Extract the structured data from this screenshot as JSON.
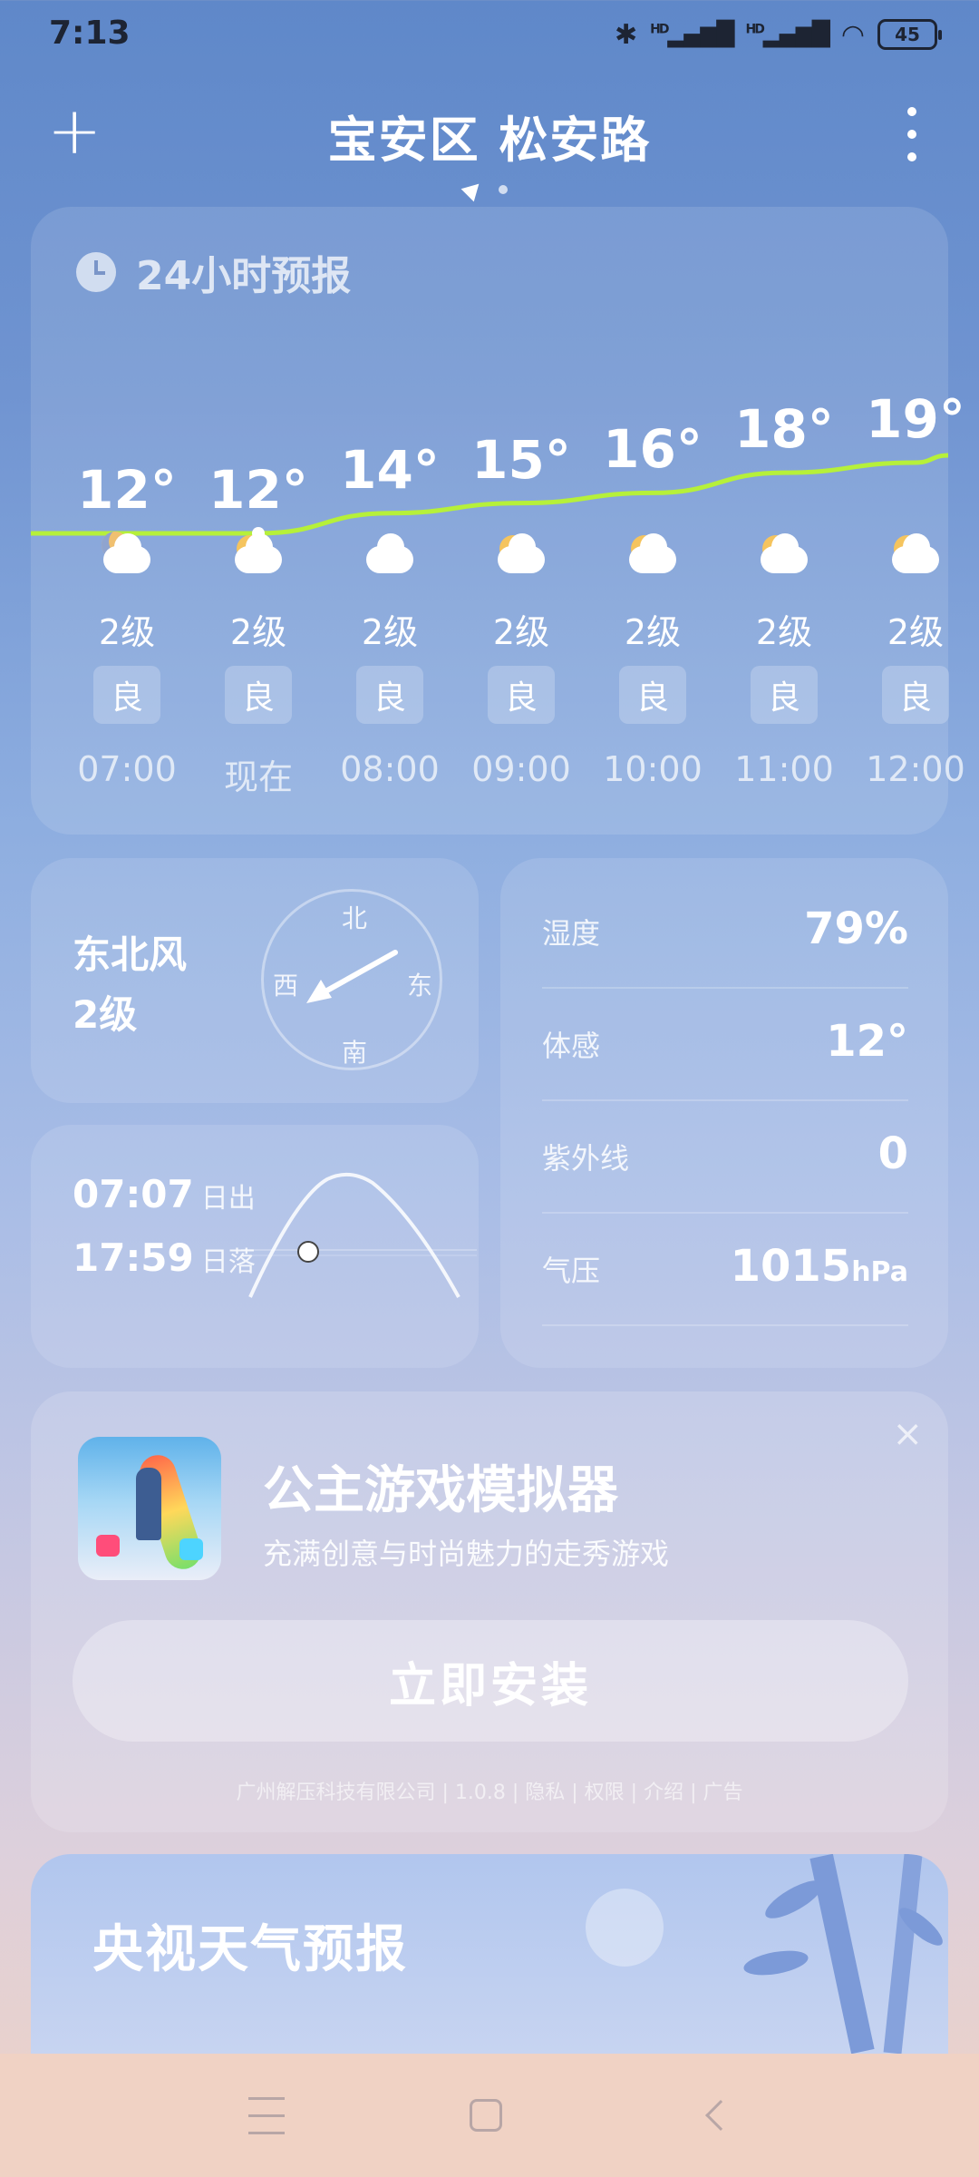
{
  "status_bar": {
    "time": "7:13",
    "signal1": "HD",
    "signal2": "HD",
    "battery": "45"
  },
  "header": {
    "title": "宝安区 松安路"
  },
  "forecast": {
    "title": "24小时预报",
    "hours": [
      {
        "temp": "12°",
        "icon": "night-cloud-icon",
        "wind": "2级",
        "aqi": "良",
        "time": "07:00"
      },
      {
        "temp": "12°",
        "icon": "partly-cloudy-icon",
        "wind": "2级",
        "aqi": "良",
        "time": "现在"
      },
      {
        "temp": "14°",
        "icon": "cloudy-icon",
        "wind": "2级",
        "aqi": "良",
        "time": "08:00"
      },
      {
        "temp": "15°",
        "icon": "partly-cloudy-icon",
        "wind": "2级",
        "aqi": "良",
        "time": "09:00"
      },
      {
        "temp": "16°",
        "icon": "partly-cloudy-icon",
        "wind": "2级",
        "aqi": "良",
        "time": "10:00"
      },
      {
        "temp": "18°",
        "icon": "partly-cloudy-icon",
        "wind": "2级",
        "aqi": "良",
        "time": "11:00"
      },
      {
        "temp": "19°",
        "icon": "partly-cloudy-icon",
        "wind": "2级",
        "aqi": "良",
        "time": "12:00"
      }
    ],
    "curve_color": "#b6f03a"
  },
  "wind": {
    "direction": "东北风",
    "level": "2级",
    "compass": {
      "north": "北",
      "south": "南",
      "east": "东",
      "west": "西"
    }
  },
  "sun": {
    "sunrise_time": "07:07",
    "sunrise_label": "日出",
    "sunset_time": "17:59",
    "sunset_label": "日落"
  },
  "details": [
    {
      "label": "湿度",
      "value": "79%",
      "unit": ""
    },
    {
      "label": "体感",
      "value": "12°",
      "unit": ""
    },
    {
      "label": "紫外线",
      "value": "0",
      "unit": ""
    },
    {
      "label": "气压",
      "value": "1015",
      "unit": "hPa"
    }
  ],
  "ad": {
    "title": "公主游戏模拟器",
    "subtitle": "充满创意与时尚魅力的走秀游戏",
    "button": "立即安装",
    "meta": "广州解压科技有限公司 | 1.0.8 | 隐私 | 权限 | 介绍 | 广告",
    "close": "×"
  },
  "cctv": {
    "title": "央视天气预报"
  }
}
